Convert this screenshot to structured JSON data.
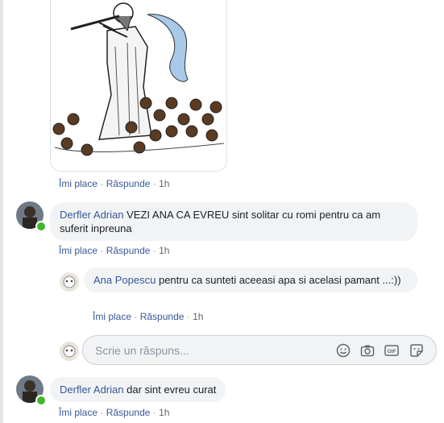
{
  "comments": [
    {
      "actions": {
        "like": "Îmi place",
        "reply": "Răspunde",
        "time": "1h"
      }
    },
    {
      "author": "Derfler Adrian",
      "text": "VEZI ANA CA EVREU sint solitar cu romi pentru ca am suferit inpreuna",
      "actions": {
        "like": "Îmi place",
        "reply": "Răspunde",
        "time": "1h"
      },
      "reply": {
        "author": "Ana Popescu",
        "text": "pentru ca sunteti aceeasi apa si acelasi pamant ...:))",
        "actions": {
          "like": "Îmi place",
          "reply": "Răspunde",
          "time": "1h"
        }
      }
    },
    {
      "author": "Derfler Adrian",
      "text": "dar sint evreu curat",
      "actions": {
        "like": "Îmi place",
        "reply": "Răspunde",
        "time": "1h"
      }
    }
  ],
  "reply_box": {
    "placeholder": "Scrie un răspuns...",
    "icons": [
      "emoji-icon",
      "camera-icon",
      "gif-icon",
      "sticker-icon"
    ],
    "gif_label": "GIF"
  },
  "separator": "·",
  "colors": {
    "link": "#385898",
    "bubble": "#f2f3f5",
    "online": "#42b72a"
  }
}
